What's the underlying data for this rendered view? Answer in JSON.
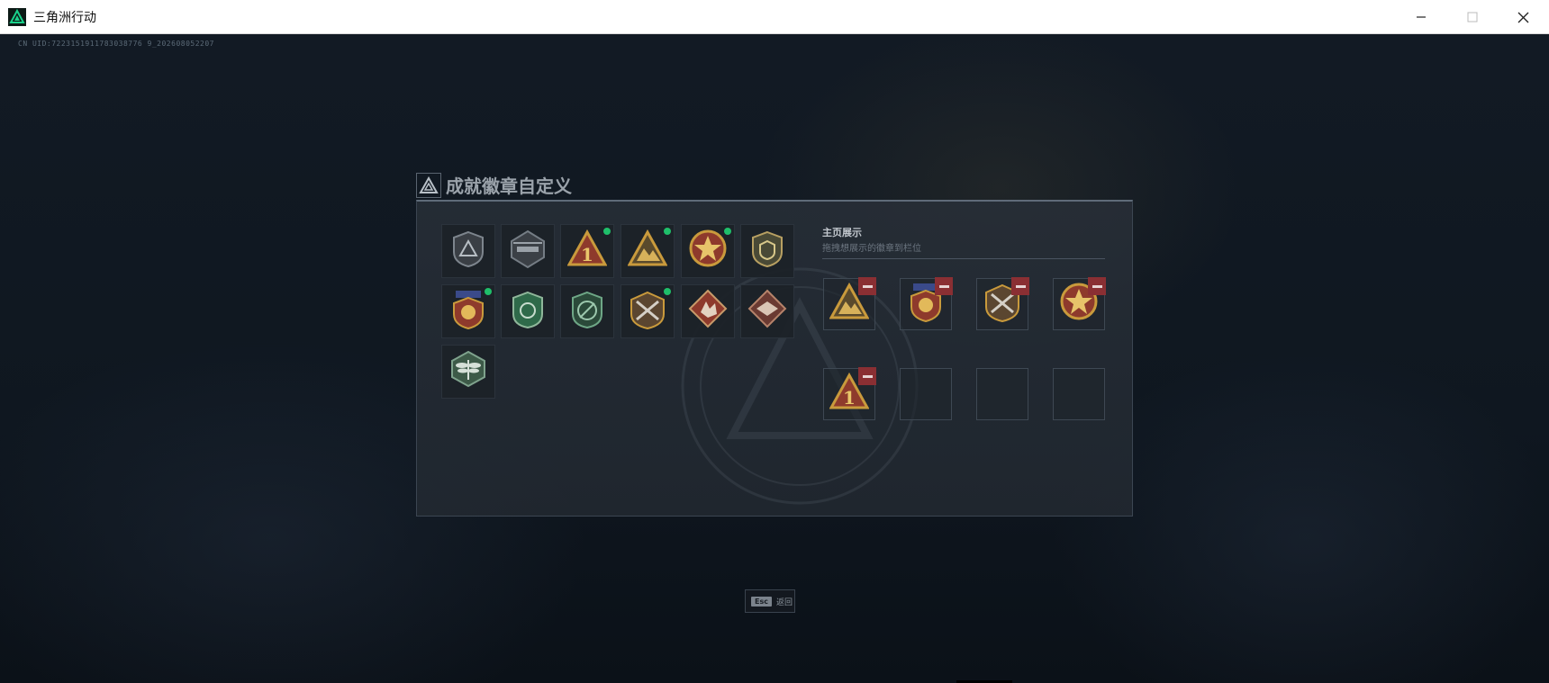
{
  "window": {
    "title": "三角洲行动",
    "controls": [
      "minimize",
      "maximize",
      "close"
    ]
  },
  "uid": "CN UID:7223151911783038776 9_202608052207",
  "dialog": {
    "title": "成就徽章自定义",
    "display_title": "主页展示",
    "display_subtitle": "拖拽想展示的徽章到栏位"
  },
  "badges": [
    {
      "icon": "shield-triangle-badge",
      "new": false
    },
    {
      "icon": "helicopter-badge",
      "new": false
    },
    {
      "icon": "number-one-triangle-badge",
      "new": true
    },
    {
      "icon": "mountain-triangle-badge",
      "new": true
    },
    {
      "icon": "star-wreath-badge",
      "new": true
    },
    {
      "icon": "green-shield-badge",
      "new": false
    },
    {
      "icon": "gold-medal-badge",
      "new": true
    },
    {
      "icon": "green-lion-badge",
      "new": false
    },
    {
      "icon": "green-wreath-badge",
      "new": false
    },
    {
      "icon": "crossed-weapons-badge",
      "new": true
    },
    {
      "icon": "diamond-wolf-badge",
      "new": false
    },
    {
      "icon": "diamond-eagle-badge",
      "new": false
    },
    {
      "icon": "hexagon-dragonfly-badge",
      "new": false
    }
  ],
  "display_slots": [
    {
      "icon": "mountain-triangle-badge",
      "filled": true
    },
    {
      "icon": "gold-medal-badge",
      "filled": true
    },
    {
      "icon": "crossed-weapons-badge",
      "filled": true
    },
    {
      "icon": "star-wreath-badge",
      "filled": true
    },
    {
      "icon": "number-one-triangle-badge",
      "filled": true
    },
    {
      "icon": "",
      "filled": false
    },
    {
      "icon": "",
      "filled": false
    },
    {
      "icon": "",
      "filled": false
    }
  ],
  "footer": {
    "esc_key": "Esc",
    "esc_label": "返回"
  },
  "colors": {
    "new_dot": "#1fbf6a",
    "remove": "#8a2f33",
    "gold": "#c99a3c",
    "green": "#2f6a4a",
    "red_badge": "#8e3a2c"
  }
}
